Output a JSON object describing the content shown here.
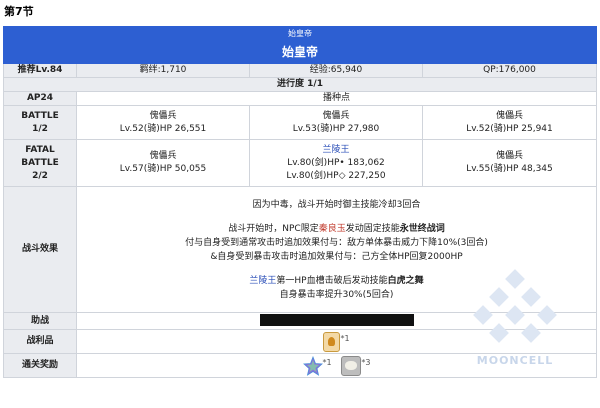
{
  "section_title": "第7节",
  "banner": {
    "small": "始皇帝",
    "big": "始皇帝"
  },
  "info": {
    "recommend": "推荐Lv.84",
    "bond": "羁绊:1,710",
    "exp": "经验:65,940",
    "qp": "QP:176,000"
  },
  "progress": "进行度 1/1",
  "ap": {
    "label": "AP24",
    "value": "播种点"
  },
  "battle1": {
    "label_line1": "BATTLE",
    "label_line2": "1/2",
    "enemies": [
      {
        "name": "傀儡兵",
        "stats": "Lv.52(骑)HP 26,551"
      },
      {
        "name": "傀儡兵",
        "stats": "Lv.53(骑)HP 27,980"
      },
      {
        "name": "傀儡兵",
        "stats": "Lv.52(骑)HP 25,941"
      }
    ]
  },
  "battle2": {
    "label_line1": "FATAL BATTLE",
    "label_line2": "2/2",
    "left": {
      "name": "傀儡兵",
      "stats": "Lv.57(骑)HP 50,055"
    },
    "middle": {
      "name": "兰陵王",
      "stats1": "Lv.80(剑)HP• 183,062",
      "stats2": "Lv.80(剑)HP◇ 227,250"
    },
    "right": {
      "name": "傀儡兵",
      "stats": "Lv.55(骑)HP 48,345"
    }
  },
  "effects": {
    "label": "战斗效果",
    "line1": "因为中毒，战斗开始时御主技能冷却3回合",
    "line2_pre": "战斗开始时，NPC限定",
    "line2_link": "秦良玉",
    "line2_mid": "发动固定技能",
    "line2_bold": "永世终战词",
    "line3": "付与自身受到通常攻击时追加效果付与：敌方单体暴击威力下降10%(3回合)",
    "line4": "&自身受到暴击攻击时追加效果付与：己方全体HP回复2000HP",
    "line5_link": "兰陵王",
    "line5_mid": "第一HP血槽击破后发动技能",
    "line5_bold": "白虎之舞",
    "line6": "自身暴击率提升30%(5回合)"
  },
  "support": {
    "label": "助战"
  },
  "drops": {
    "label": "战利品",
    "qty": "*1"
  },
  "rewards": {
    "label": "通关奖励",
    "qty1": "*1",
    "qty2": "*3"
  },
  "watermark": "MOONCELL"
}
